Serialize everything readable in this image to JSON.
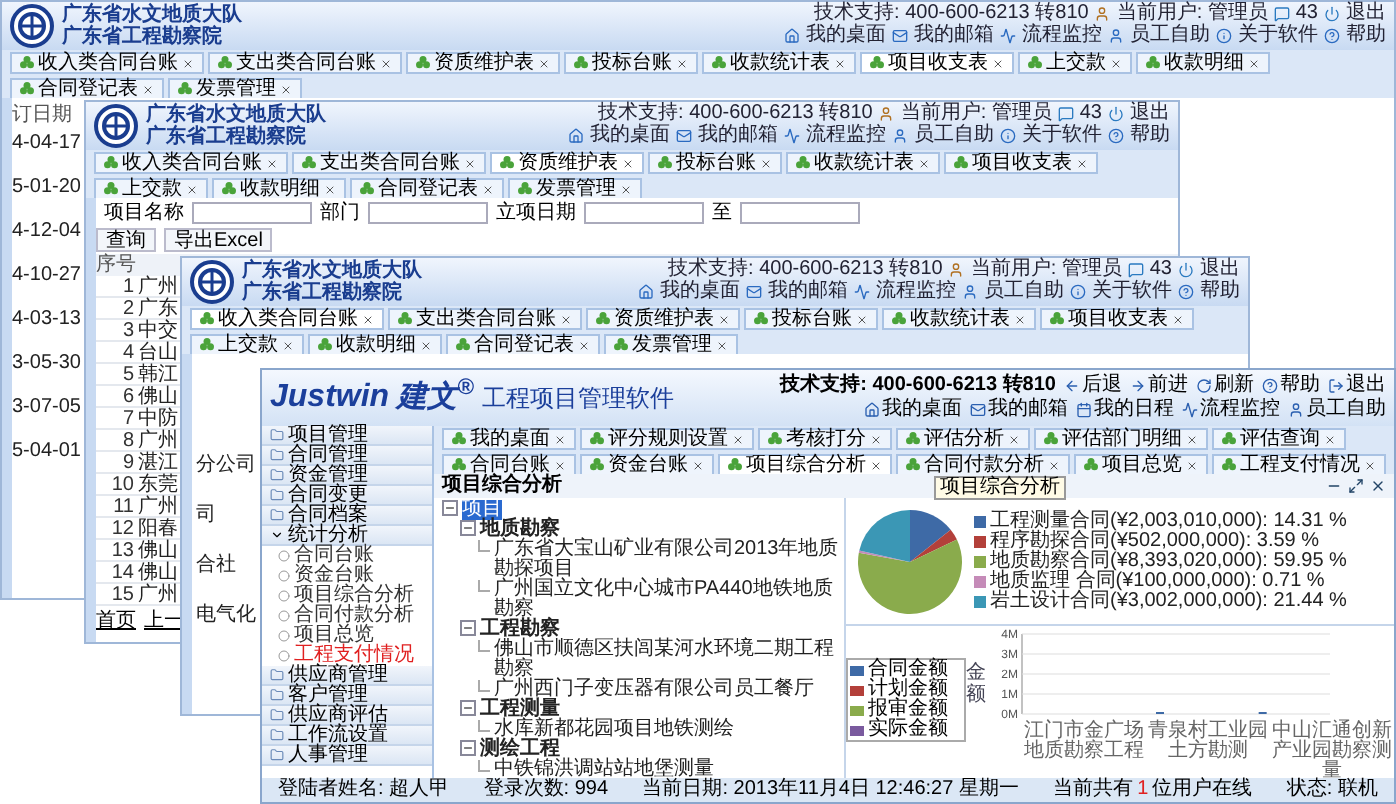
{
  "back_windows": [
    {
      "kind": "dates",
      "header": {
        "org": [
          "广东省水文地质大队",
          "广东省工程勘察院"
        ],
        "support": "技术支持: 400-600-6213 转810",
        "user": "当前用户: 管理员",
        "messages": "43",
        "logout": "退出",
        "links": [
          "我的桌面",
          "我的邮箱",
          "流程监控",
          "员工自助",
          "关于软件",
          "帮助"
        ]
      },
      "tabs": [
        {
          "label": "收入类合同台账",
          "selected": false
        },
        {
          "label": "支出类合同台账",
          "selected": false
        },
        {
          "label": "资质维护表",
          "selected": false
        },
        {
          "label": "投标台账",
          "selected": false
        },
        {
          "label": "收款统计表",
          "selected": false
        },
        {
          "label": "项目收支表",
          "selected": true
        },
        {
          "label": "上交款",
          "selected": false
        },
        {
          "label": "收款明细",
          "selected": false
        },
        {
          "label": "合同登记表",
          "selected": false
        },
        {
          "label": "发票管理",
          "selected": false
        }
      ],
      "column": {
        "header": "订日期",
        "cells": [
          "4-04-17",
          "5-01-20",
          "4-12-04",
          "4-10-27",
          "4-03-13",
          "3-05-30",
          "3-07-05",
          "5-04-01"
        ]
      }
    },
    {
      "kind": "search",
      "header": {
        "org": [
          "广东省水文地质大队",
          "广东省工程勘察院"
        ],
        "support": "技术支持: 400-600-6213 转810",
        "user": "当前用户: 管理员",
        "messages": "43",
        "logout": "退出",
        "links": [
          "我的桌面",
          "我的邮箱",
          "流程监控",
          "员工自助",
          "关于软件",
          "帮助"
        ]
      },
      "tabs": [
        {
          "label": "收入类合同台账",
          "selected": false
        },
        {
          "label": "支出类合同台账",
          "selected": false
        },
        {
          "label": "资质维护表",
          "selected": true
        },
        {
          "label": "投标台账",
          "selected": false
        },
        {
          "label": "收款统计表",
          "selected": false
        },
        {
          "label": "项目收支表",
          "selected": false
        },
        {
          "label": "上交款",
          "selected": false
        },
        {
          "label": "收款明细",
          "selected": false
        },
        {
          "label": "合同登记表",
          "selected": false
        },
        {
          "label": "发票管理",
          "selected": false
        }
      ],
      "search": {
        "fields": [
          "项目名称",
          "部门",
          "立项日期",
          "至"
        ],
        "buttons": [
          "查询",
          "导出Excel"
        ]
      },
      "table": {
        "columns": [
          "序号"
        ],
        "rows": [
          {
            "no": "1",
            "name": "广州"
          },
          {
            "no": "2",
            "name": "广东"
          },
          {
            "no": "3",
            "name": "中交"
          },
          {
            "no": "4",
            "name": "台山"
          },
          {
            "no": "5",
            "name": "韩江"
          },
          {
            "no": "6",
            "name": "佛山"
          },
          {
            "no": "7",
            "name": "中防"
          },
          {
            "no": "8",
            "name": "广州"
          },
          {
            "no": "9",
            "name": "湛江"
          },
          {
            "no": "10",
            "name": "东莞"
          },
          {
            "no": "11",
            "name": "广州"
          },
          {
            "no": "12",
            "name": "阳春"
          },
          {
            "no": "13",
            "name": "佛山"
          },
          {
            "no": "14",
            "name": "佛山"
          },
          {
            "no": "15",
            "name": "广州"
          }
        ]
      },
      "pager": [
        "首页",
        "上一"
      ]
    },
    {
      "kind": "list",
      "header": {
        "org": [
          "广东省水文地质大队",
          "广东省工程勘察院"
        ],
        "support": "技术支持: 400-600-6213 转810",
        "user": "当前用户: 管理员",
        "messages": "43",
        "logout": "退出",
        "links": [
          "我的桌面",
          "我的邮箱",
          "流程监控",
          "员工自助",
          "关于软件",
          "帮助"
        ]
      },
      "tabs": [
        {
          "label": "收入类合同台账",
          "selected": true
        },
        {
          "label": "支出类合同台账",
          "selected": false
        },
        {
          "label": "资质维护表",
          "selected": false
        },
        {
          "label": "投标台账",
          "selected": false
        },
        {
          "label": "收款统计表",
          "selected": false
        },
        {
          "label": "项目收支表",
          "selected": false
        },
        {
          "label": "上交款",
          "selected": false
        },
        {
          "label": "收款明细",
          "selected": false
        },
        {
          "label": "合同登记表",
          "selected": false
        },
        {
          "label": "发票管理",
          "selected": false
        }
      ],
      "items": [
        "分公司",
        "司",
        "合社",
        "电气化"
      ]
    }
  ],
  "app": {
    "brand": "Justwin",
    "brand_cn": "建文$^{®}$",
    "title": "工程项目管理软件",
    "nav": [
      "后退",
      "前进",
      "刷新",
      "帮助",
      "退出"
    ],
    "support": "技术支持: 400-600-6213 转810",
    "links": [
      "我的桌面",
      "我的邮箱",
      "我的日程",
      "流程监控",
      "员工自助"
    ],
    "menu": [
      {
        "label": "项目管理",
        "expanded": false
      },
      {
        "label": "合同管理",
        "expanded": false
      },
      {
        "label": "资金管理",
        "expanded": false
      },
      {
        "label": "合同变更",
        "expanded": false
      },
      {
        "label": "合同档案",
        "expanded": false
      },
      {
        "label": "统计分析",
        "expanded": true,
        "children": [
          {
            "label": "合同台账",
            "selected": false
          },
          {
            "label": "资金台账",
            "selected": false
          },
          {
            "label": "项目综合分析",
            "selected": false
          },
          {
            "label": "合同付款分析",
            "selected": false
          },
          {
            "label": "项目总览",
            "selected": false
          },
          {
            "label": "工程支付情况",
            "selected": true
          }
        ]
      },
      {
        "label": "供应商管理",
        "expanded": false
      },
      {
        "label": "客户管理",
        "expanded": false
      },
      {
        "label": "供应商评估",
        "expanded": false
      },
      {
        "label": "工作流设置",
        "expanded": false
      },
      {
        "label": "人事管理",
        "expanded": false
      }
    ],
    "tabs": [
      {
        "label": "我的桌面",
        "selected": false
      },
      {
        "label": "评分规则设置",
        "selected": false
      },
      {
        "label": "考核打分",
        "selected": false
      },
      {
        "label": "评估分析",
        "selected": false
      },
      {
        "label": "评估部门明细",
        "selected": false
      },
      {
        "label": "评估查询",
        "selected": false
      },
      {
        "label": "合同台账",
        "selected": false
      },
      {
        "label": "资金台账",
        "selected": false
      },
      {
        "label": "项目综合分析",
        "selected": true
      },
      {
        "label": "合同付款分析",
        "selected": false
      },
      {
        "label": "项目总览",
        "selected": false
      },
      {
        "label": "工程支付情况",
        "selected": false
      }
    ],
    "panel_title": "项目综合分析",
    "tooltip": "项目综合分析",
    "tree": [
      {
        "label": "项目",
        "selected": true,
        "expanded": true,
        "children": [
          {
            "label": "地质勘察",
            "expanded": true,
            "children": [
              {
                "label": "广东省大宝山矿业有限公司2013年地质勘探项目"
              },
              {
                "label": "广州国立文化中心城市PA440地铁地质勘察"
              }
            ]
          },
          {
            "label": "工程勘察",
            "expanded": true,
            "children": [
              {
                "label": "佛山市顺德区扶闾某河水环境二期工程勘察"
              },
              {
                "label": "广州西门子变压器有限公司员工餐厅"
              }
            ]
          },
          {
            "label": "工程测量",
            "expanded": true,
            "children": [
              {
                "label": "水库新都花园项目地铁测绘"
              }
            ]
          },
          {
            "label": "测绘工程",
            "expanded": true,
            "children": [
              {
                "label": "中铁锦洪调站站地堡测量"
              }
            ]
          }
        ]
      }
    ],
    "pie": {
      "chart_data": {
        "type": "pie",
        "categories": [
          "工程测量合同",
          "程序勘探合同",
          "地质勘察合同",
          "地质监理 合同",
          "岩土设计合同"
        ],
        "series": [
          {
            "values": [
              14.31,
              3.59,
              59.95,
              0.71,
              21.44
            ]
          }
        ],
        "colors": [
          "#3e6aa6",
          "#b3403a",
          "#8aab4c",
          "#c58bb8",
          "#3b97b5"
        ],
        "legend": "right",
        "value_labels": [
          "(¥2,003,010,000): 14.31 %",
          "(¥502,000,000): 3.59 %",
          "(¥8,393,020,000): 59.95 %",
          "(¥100,000,000): 0.71 %",
          "(¥3,002,000,000): 21.44 %"
        ]
      }
    },
    "bars": {
      "chart_data": {
        "type": "bar",
        "ylabel": "金额",
        "categories": [
          "江门市金广场地质勘察工程",
          "青泉村工业园土方勘测",
          "中山汇通创新产业园勘察测量"
        ],
        "series": [
          {
            "name": "合同金额",
            "color": "#3e6aa6",
            "values": [
              null,
              0.1,
              0.1
            ]
          },
          {
            "name": "计划金额",
            "color": "#b3403a",
            "values": [
              null,
              null,
              null
            ]
          },
          {
            "name": "报审金额",
            "color": "#8aab4c",
            "values": [
              null,
              null,
              null
            ]
          },
          {
            "name": "实际金额",
            "color": "#7a5a9e",
            "values": [
              null,
              null,
              null
            ]
          }
        ],
        "ylim": [
          0,
          4
        ],
        "grid": true,
        "yticks": [
          {
            "value": 0,
            "label": "0M"
          },
          {
            "value": 1,
            "label": "1M"
          },
          {
            "value": 2,
            "label": "2M"
          },
          {
            "value": 3,
            "label": "3M"
          },
          {
            "value": 4,
            "label": "4M"
          }
        ]
      }
    },
    "status": {
      "user": "登陆者姓名: 超人甲",
      "logins": "登录次数: 994",
      "date": "当前日期: 2013年11月4日 12:46:27 星期一",
      "online_prefix": "当前共有",
      "online_count": "1",
      "online_suffix": "位用户在线",
      "state": "状态: 联机"
    }
  }
}
